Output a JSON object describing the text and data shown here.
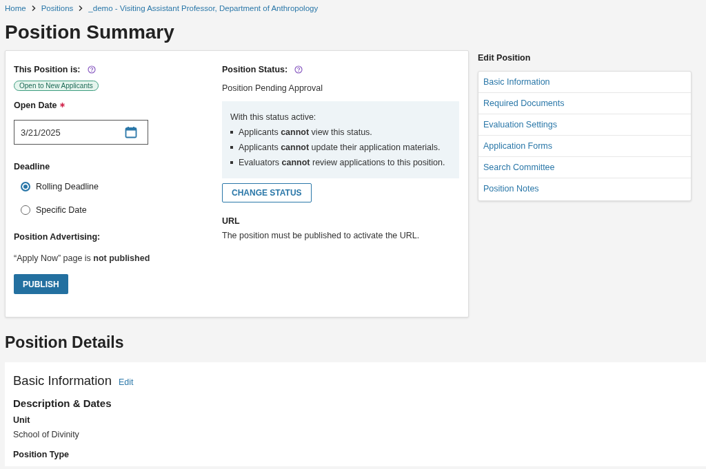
{
  "breadcrumb": [
    {
      "label": "Home"
    },
    {
      "label": "Positions"
    },
    {
      "label": "_demo - Visiting Assistant Professor, Department of Anthropology"
    }
  ],
  "page_title": "Position Summary",
  "summary": {
    "position_is": {
      "label": "This Position is:",
      "badge": "Open to New Applicants"
    },
    "open_date": {
      "label": "Open Date",
      "required": true,
      "value": "3/21/2025"
    },
    "deadline": {
      "label": "Deadline",
      "options": [
        {
          "label": "Rolling Deadline",
          "selected": true
        },
        {
          "label": "Specific Date",
          "selected": false
        }
      ]
    },
    "advertising": {
      "label": "Position Advertising:",
      "text": "“Apply Now” page is **not published**",
      "button": "PUBLISH"
    },
    "status": {
      "label": "Position Status:",
      "value": "Position Pending Approval",
      "note_intro": "With this status active:",
      "note_items": [
        "Applicants **cannot** view this status.",
        "Applicants **cannot** update their application materials.",
        "Evaluators **cannot** review applications to this position."
      ],
      "button": "CHANGE STATUS"
    },
    "url": {
      "label": "URL",
      "text": "The position must be published to activate the URL."
    }
  },
  "sidebar": {
    "title": "Edit Position",
    "items": [
      "Basic Information",
      "Required Documents",
      "Evaluation Settings",
      "Application Forms",
      "Search Committee",
      "Position Notes"
    ]
  },
  "details": {
    "heading": "Position Details",
    "section_title": "Basic Information",
    "edit_link": "Edit",
    "subsection": "Description & Dates",
    "fields": [
      {
        "label": "Unit",
        "value": "School of Divinity"
      },
      {
        "label": "Position Type"
      }
    ]
  }
}
